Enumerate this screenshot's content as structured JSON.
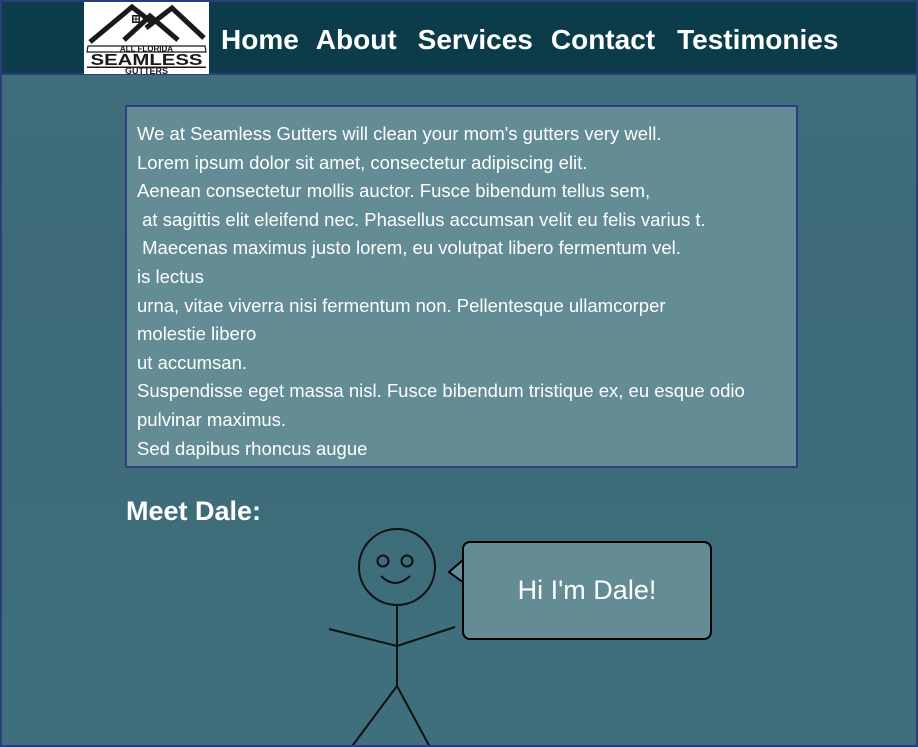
{
  "header": {
    "logo": {
      "line1": "ALL FLORIDA",
      "line2": "SEAMLESS",
      "line3": "GUTTERS"
    },
    "nav": [
      {
        "label": "Home"
      },
      {
        "label": "About"
      },
      {
        "label": "Services"
      },
      {
        "label": "Contact"
      },
      {
        "label": "Testimonies"
      }
    ]
  },
  "main": {
    "paragraph_lines": [
      "We at Seamless Gutters will clean your mom's gutters very well.",
      "Lorem ipsum dolor sit amet, consectetur adipiscing elit.",
      "Aenean consectetur mollis auctor. Fusce bibendum tellus sem,",
      " at sagittis elit eleifend nec. Phasellus accumsan velit eu felis varius t.",
      " Maecenas maximus justo lorem, eu volutpat libero fermentum vel.",
      "is lectus",
      "urna, vitae viverra nisi fermentum non. Pellentesque ullamcorper",
      "molestie libero",
      "ut accumsan.",
      "Suspendisse eget massa nisl. Fusce bibendum tristique ex, eu esque odio",
      "pulvinar maximus.",
      "Sed dapibus rhoncus augue"
    ],
    "meet_heading": "Meet Dale:",
    "speech_bubble": "Hi I'm Dale!"
  },
  "colors": {
    "navbar": "#0c3c4a",
    "page_background": "#3f6f7d",
    "content_box": "#638c95",
    "content_border": "#2d3d86",
    "text": "#ffffff"
  }
}
